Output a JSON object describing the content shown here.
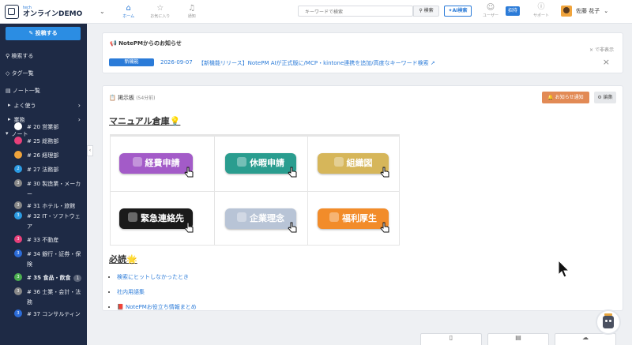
{
  "header": {
    "logo_sub": "tech",
    "logo_main": "オンラインDEMO",
    "nav": [
      {
        "label": "ホーム",
        "icon": "home-icon"
      },
      {
        "label": "お気に入り",
        "icon": "star-icon"
      },
      {
        "label": "通知",
        "icon": "bell-icon"
      }
    ],
    "search_placeholder": "キーワードで検索",
    "search_label": "検索",
    "ai_label": "AI検索",
    "user_label": "ユーザー",
    "invite_label": "招待",
    "support_label": "サポート",
    "user_name": "佐藤 花子"
  },
  "sidebar": {
    "post_label": "投稿する",
    "search_label": "検索する",
    "tags_label": "タグ一覧",
    "notes_label": "ノート一覧",
    "favorites_label": "よく使う",
    "business_label": "業務",
    "note_label": "ノート",
    "notes": [
      {
        "label": "# 20 営業部",
        "color": "#ffffff",
        "icon": "chrome-icon"
      },
      {
        "label": "# 25 総務部",
        "color": "#e8407a",
        "icon": "share-icon"
      },
      {
        "label": "# 26 経理部",
        "color": "#f0a43c",
        "icon": "document-icon"
      },
      {
        "label": "# 27 法務部",
        "color": "#2b9be3",
        "icon": "number-icon",
        "num": "2"
      },
      {
        "label": "# 30 製造業・メーカー",
        "color": "#888",
        "icon": "number-icon",
        "num": "3"
      },
      {
        "label": "# 31 ホテル・旅館",
        "color": "#888",
        "icon": "number-icon",
        "num": "3"
      },
      {
        "label": "# 32 IT・ソフトウェア",
        "color": "#2b9be3",
        "icon": "number-icon",
        "num": "3"
      },
      {
        "label": "# 33 不動産",
        "color": "#e8407a",
        "icon": "number-icon",
        "num": "3"
      },
      {
        "label": "# 34 銀行・証券・保険",
        "color": "#2b6bd8",
        "icon": "number-icon",
        "num": "3"
      },
      {
        "label": "# 35 食品・飲食",
        "color": "#4caf50",
        "icon": "number-icon",
        "num": "3",
        "badge": "1"
      },
      {
        "label": "# 36 士業・会計・法務",
        "color": "#888",
        "icon": "number-icon",
        "num": "3"
      },
      {
        "label": "# 37 コンサルティン",
        "color": "#2b6bd8",
        "icon": "number-icon",
        "num": "3"
      }
    ]
  },
  "notice": {
    "title": "NotePMからのお知らせ",
    "hide_label": "で非表示",
    "badge": "新機能",
    "date": "2026-09-07",
    "text": "【新機能リリース】NotePM AIが正式版に/MCP・kintone連携を追加/高度なキーワード検索"
  },
  "board": {
    "title": "掲示板",
    "time": "(54分前)",
    "notify_label": "お知らせ通知",
    "edit_label": "編集",
    "section1": "マニュアル倉庫",
    "tiles": [
      {
        "label": "経費申請",
        "bg": "#a35bc8",
        "icon": "coin-icon"
      },
      {
        "label": "休暇申請",
        "bg": "#2a9d8f",
        "icon": "palm-icon"
      },
      {
        "label": "組織図",
        "bg": "#d6b65a",
        "icon": "people-icon"
      },
      {
        "label": "緊急連絡先",
        "bg": "#1a1a1a",
        "icon": "alert-icon"
      },
      {
        "label": "企業理念",
        "bg": "#b8c4d6",
        "icon": "trophy-icon"
      },
      {
        "label": "福利厚生",
        "bg": "#f28c2a",
        "icon": "hand-icon"
      }
    ],
    "section2": "必読",
    "links": [
      "検索にヒットしなかったとき",
      "社内用語集",
      "NotePMお役立ち情報まとめ"
    ]
  }
}
